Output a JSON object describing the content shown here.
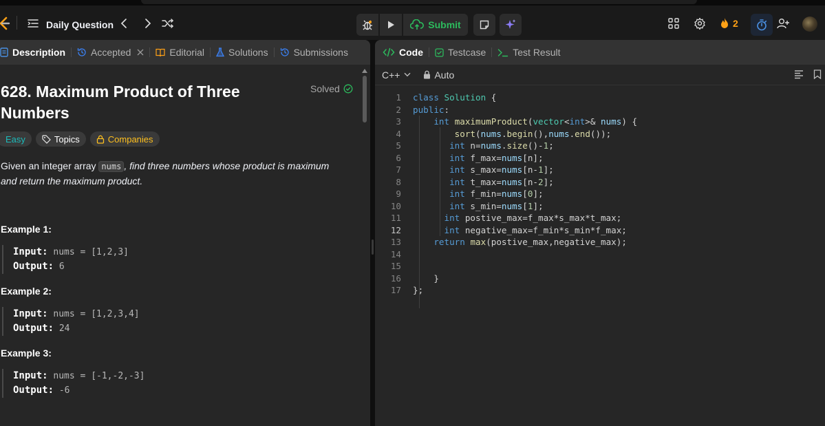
{
  "nav": {
    "daily_question": "Daily Question",
    "submit_label": "Submit",
    "streak_count": "2",
    "accent_color": "#ffa116",
    "submit_color": "#2cbb5d"
  },
  "left_tabs": [
    {
      "label": "Description"
    },
    {
      "label": "Accepted"
    },
    {
      "label": "Editorial"
    },
    {
      "label": "Solutions"
    },
    {
      "label": "Submissions"
    }
  ],
  "problem": {
    "title": "628. Maximum Product of Three Numbers",
    "status": "Solved",
    "difficulty": "Easy",
    "topics_label": "Topics",
    "companies_label": "Companies",
    "desc_before": "Given an integer array ",
    "desc_code": "nums",
    "desc_after": ", find three numbers whose product is maximum and return the maximum product.",
    "examples": [
      {
        "title": "Example 1:",
        "input_label": "Input:",
        "input": "nums = [1,2,3]",
        "output_label": "Output:",
        "output": "6"
      },
      {
        "title": "Example 2:",
        "input_label": "Input:",
        "input": "nums = [1,2,3,4]",
        "output_label": "Output:",
        "output": "24"
      },
      {
        "title": "Example 3:",
        "input_label": "Input:",
        "input": "nums = [-1,-2,-3]",
        "output_label": "Output:",
        "output": "-6"
      }
    ]
  },
  "right_tabs": [
    {
      "label": "Code"
    },
    {
      "label": "Testcase"
    },
    {
      "label": "Test Result"
    }
  ],
  "editor": {
    "language": "C++",
    "mode": "Auto",
    "current_line": 12,
    "lines": [
      "class Solution {",
      "public:",
      "    int maximumProduct(vector<int>& nums) {",
      "        sort(nums.begin(),nums.end());",
      "       int n=nums.size()-1;",
      "       int f_max=nums[n];",
      "       int s_max=nums[n-1];",
      "       int t_max=nums[n-2];",
      "       int f_min=nums[0];",
      "       int s_min=nums[1];",
      "      int postive_max=f_max*s_max*t_max;",
      "      int negative_max=f_min*s_min*f_max;",
      "    return max(postive_max,negative_max);",
      "",
      "",
      "    }",
      "};"
    ]
  }
}
